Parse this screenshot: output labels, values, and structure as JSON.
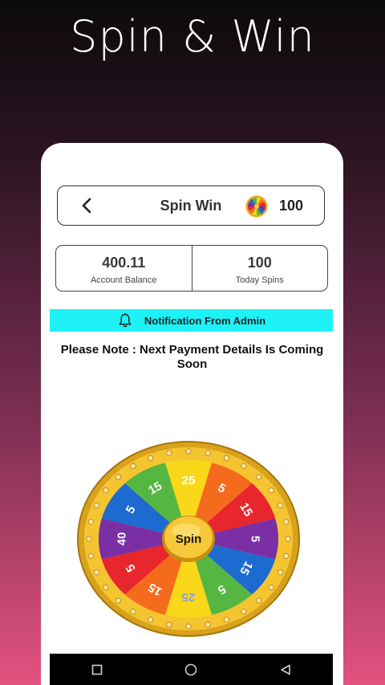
{
  "screen_title": "Spin & Win",
  "topbar": {
    "back_icon": "chevron-left-icon",
    "title": "Spin Win",
    "coin_icon": "color-wheel-icon",
    "coins": "100"
  },
  "stats": {
    "balance_value": "400.11",
    "balance_label": "Account Balance",
    "spins_value": "100",
    "spins_label": "Today Spins"
  },
  "notification": {
    "icon": "bell-icon",
    "text": "Notification From Admin",
    "bg_color": "#1ef2f6"
  },
  "note": "Please Note : Next Payment Details Is Coming Soon",
  "wheel": {
    "center_label": "Spin",
    "segments": [
      {
        "label": "25",
        "color": "#f9d81a",
        "text_color": "#ffffff"
      },
      {
        "label": "5",
        "color": "#f56b1e",
        "text_color": "#ffffff"
      },
      {
        "label": "15",
        "color": "#e8262d",
        "text_color": "#ffffff"
      },
      {
        "label": "5",
        "color": "#7b2fa5",
        "text_color": "#ffffff"
      },
      {
        "label": "15",
        "color": "#1d6bd1",
        "text_color": "#ffffff"
      },
      {
        "label": "5",
        "color": "#56b642",
        "text_color": "#ffffff"
      },
      {
        "label": "25",
        "color": "#f9d81a",
        "text_color": "#8aa0e0"
      },
      {
        "label": "15",
        "color": "#f56b1e",
        "text_color": "#ffffff"
      },
      {
        "label": "5",
        "color": "#e8262d",
        "text_color": "#ffffff"
      },
      {
        "label": "40",
        "color": "#7b2fa5",
        "text_color": "#ffffff"
      },
      {
        "label": "5",
        "color": "#1d6bd1",
        "text_color": "#ffffff"
      },
      {
        "label": "15",
        "color": "#56b642",
        "text_color": "#ffffff"
      }
    ]
  },
  "navbar": {
    "recents_icon": "square-icon",
    "home_icon": "circle-icon",
    "back_icon": "triangle-back-icon"
  }
}
